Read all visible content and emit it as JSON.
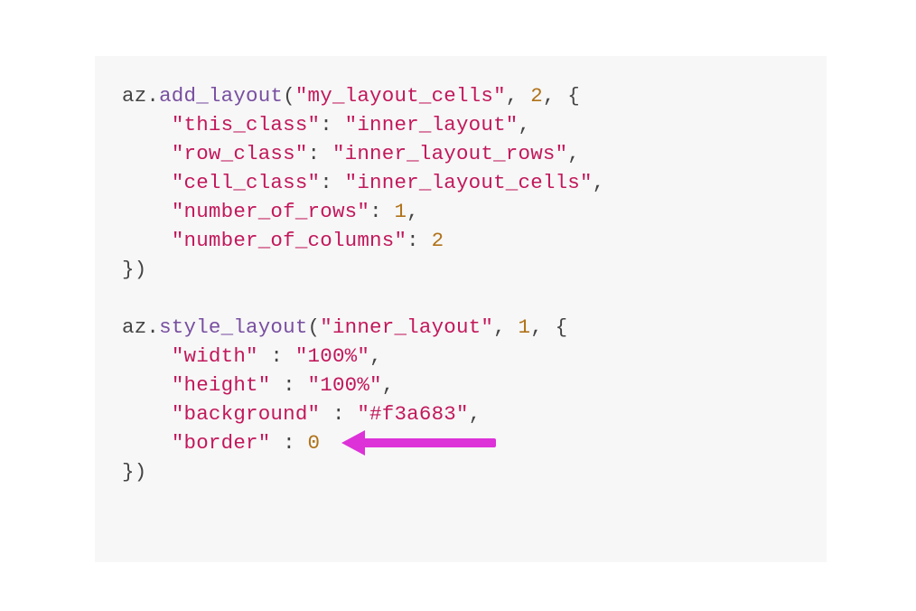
{
  "code": {
    "line1": {
      "t1": "az",
      "t2": ".",
      "t3": "add_layout",
      "t4": "(",
      "t5": "\"my_layout_cells\"",
      "t6": ", ",
      "t7": "2",
      "t8": ", {"
    },
    "line2": {
      "t1": "    ",
      "t2": "\"this_class\"",
      "t3": ": ",
      "t4": "\"inner_layout\"",
      "t5": ","
    },
    "line3": {
      "t1": "    ",
      "t2": "\"row_class\"",
      "t3": ": ",
      "t4": "\"inner_layout_rows\"",
      "t5": ","
    },
    "line4": {
      "t1": "    ",
      "t2": "\"cell_class\"",
      "t3": ": ",
      "t4": "\"inner_layout_cells\"",
      "t5": ","
    },
    "line5": {
      "t1": "    ",
      "t2": "\"number_of_rows\"",
      "t3": ": ",
      "t4": "1",
      "t5": ","
    },
    "line6": {
      "t1": "    ",
      "t2": "\"number_of_columns\"",
      "t3": ": ",
      "t4": "2"
    },
    "line7": {
      "t1": "})"
    },
    "line8": {
      "t1": ""
    },
    "line9": {
      "t1": "az",
      "t2": ".",
      "t3": "style_layout",
      "t4": "(",
      "t5": "\"inner_layout\"",
      "t6": ", ",
      "t7": "1",
      "t8": ", {"
    },
    "line10": {
      "t1": "    ",
      "t2": "\"width\"",
      "t3": " : ",
      "t4": "\"100%\"",
      "t5": ","
    },
    "line11": {
      "t1": "    ",
      "t2": "\"height\"",
      "t3": " : ",
      "t4": "\"100%\"",
      "t5": ","
    },
    "line12": {
      "t1": "    ",
      "t2": "\"background\"",
      "t3": " : ",
      "t4": "\"#f3a683\"",
      "t5": ","
    },
    "line13": {
      "t1": "    ",
      "t2": "\"border\"",
      "t3": " : ",
      "t4": "0"
    },
    "line14": {
      "t1": "})"
    }
  },
  "annotation": {
    "arrow_color": "#DD32D8",
    "points_to": "border : 0"
  }
}
